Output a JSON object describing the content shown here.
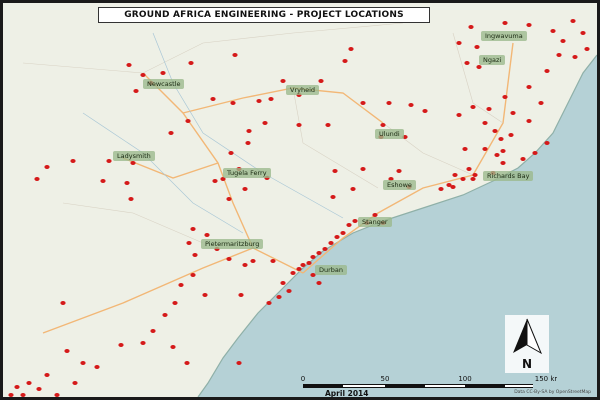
{
  "title": "GROUND AFRICA ENGINEERING - PROJECT LOCATIONS",
  "colors": {
    "land": "#eef0e6",
    "sea": "#b5d1d6",
    "marker": "#d51a1a",
    "road": "#f2b776",
    "label_bg": "#9fbf8e"
  },
  "places": [
    {
      "name": "Newcastle"
    },
    {
      "name": "Vryheid"
    },
    {
      "name": "Ladysmith"
    },
    {
      "name": "Ulundi"
    },
    {
      "name": "Tugela Ferry"
    },
    {
      "name": "Eshowe"
    },
    {
      "name": "Richards Bay"
    },
    {
      "name": "Stanger"
    },
    {
      "name": "Pietermaritzburg"
    },
    {
      "name": "Durban"
    },
    {
      "name": "Ingwavuma"
    },
    {
      "name": "Ngazi"
    }
  ],
  "scale": {
    "ticks": [
      "0",
      "50",
      "100",
      "150 km"
    ],
    "unit": "km"
  },
  "date": "April 2014",
  "north_label": "N",
  "credit": "Data CC-By-SA by OpenStreetMap"
}
